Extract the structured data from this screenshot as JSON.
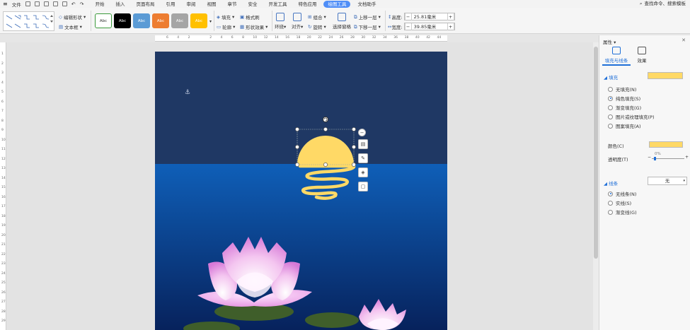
{
  "menubar": {
    "file_label": "文件",
    "tabs": [
      "开始",
      "插入",
      "页面布局",
      "引用",
      "审阅",
      "视图",
      "章节",
      "安全",
      "开发工具",
      "特色应用",
      "绘图工具",
      "文档助手"
    ],
    "active_tab": "绘图工具",
    "search_label": "查找命令、搜索模板"
  },
  "ribbon": {
    "edit_shape": "编辑形状",
    "text_box": "文本框",
    "style_swatches": [
      {
        "label": "Abc",
        "bg": "#ffffff",
        "fg": "#333333",
        "border": "#3c9a3c"
      },
      {
        "label": "Abc",
        "bg": "#000000",
        "fg": "#ffffff",
        "border": "#000000"
      },
      {
        "label": "Abc",
        "bg": "#5b9bd5",
        "fg": "#ffffff",
        "border": "#5b9bd5"
      },
      {
        "label": "Abc",
        "bg": "#ed7d31",
        "fg": "#ffffff",
        "border": "#ed7d31"
      },
      {
        "label": "Abc",
        "bg": "#a5a5a5",
        "fg": "#ffffff",
        "border": "#a5a5a5"
      },
      {
        "label": "Abc",
        "bg": "#ffc000",
        "fg": "#ffffff",
        "border": "#ffc000"
      }
    ],
    "fill": "填充",
    "format_brush": "格式刷",
    "outline": "轮廓",
    "shape_effects": "形状效果",
    "wrap": "环绕",
    "align": "对齐",
    "group": "组合",
    "rotate": "旋转",
    "selection_pane": "选择窗格",
    "bring_forward": "上移一层",
    "send_backward": "下移一层",
    "height_label": "高度:",
    "height_value": "25.81毫米",
    "width_label": "宽度:",
    "width_value": "39.85毫米",
    "minus": "−",
    "plus": "+"
  },
  "ruler": {
    "h_ticks": [
      "6",
      "4",
      "2",
      "",
      "2",
      "4",
      "6",
      "8",
      "10",
      "12",
      "14",
      "16",
      "18",
      "20",
      "22",
      "24",
      "26",
      "28",
      "30",
      "32",
      "34",
      "36",
      "38",
      "40",
      "42",
      "44"
    ],
    "v_ticks": [
      "1",
      "2",
      "3",
      "4",
      "5",
      "6",
      "7",
      "8",
      "9",
      "10",
      "11",
      "12",
      "13",
      "14",
      "15",
      "16",
      "17",
      "18",
      "19",
      "20",
      "21",
      "22",
      "23",
      "24",
      "25",
      "26",
      "27",
      "28",
      "29"
    ]
  },
  "panel": {
    "title": "属性",
    "tab_fill_line": "填充与线条",
    "tab_effects": "效果",
    "section_fill": "填充",
    "fill_options": [
      "无填充(N)",
      "纯色填充(S)",
      "渐变填充(G)",
      "图片或纹理填充(P)",
      "图案填充(A)"
    ],
    "fill_selected": 1,
    "color_label": "颜色(C)",
    "transparency_label": "透明度(T)",
    "transparency_value": "0%",
    "section_line": "线条",
    "line_value": "无",
    "line_options": [
      "无线条(N)",
      "实线(S)",
      "渐变线(G)"
    ],
    "line_selected": 0,
    "fill_color": "#ffd966"
  },
  "colors": {
    "sky": "#1f3864",
    "sea_top": "#0f5fb8",
    "sea_bottom": "#07225c",
    "sun": "#ffd966",
    "lily_pad": "#3f5e2a",
    "accent": "#4f8ef7"
  }
}
